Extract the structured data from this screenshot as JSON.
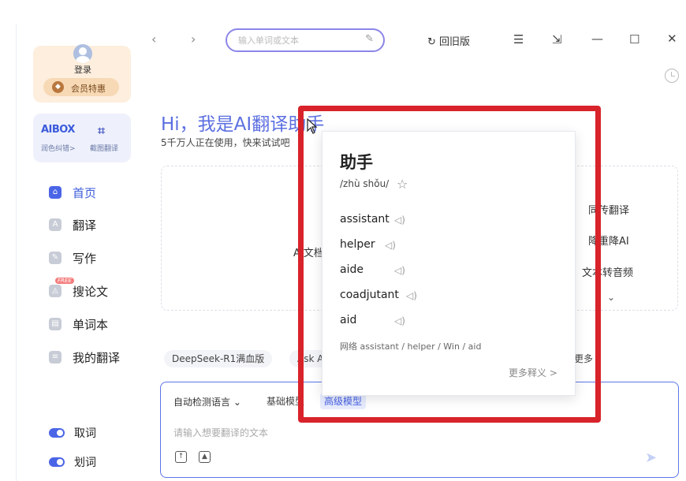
{
  "sidebar": {
    "login_label": "登录",
    "vip_label": "会员特惠",
    "vip_icon": "diamond-icon",
    "tools": {
      "polish_logo": "AIBOX",
      "polish_label": "润色纠错>",
      "screenshot_label": "截图翻译"
    },
    "nav": [
      {
        "label": "首页",
        "icon": "home-icon",
        "active": true
      },
      {
        "label": "翻译",
        "icon": "translate-icon",
        "active": false
      },
      {
        "label": "写作",
        "icon": "pen-icon",
        "active": false
      },
      {
        "label": "搜论文",
        "icon": "graduation-cap-icon",
        "active": false,
        "badge": "FREE"
      },
      {
        "label": "单词本",
        "icon": "book-icon",
        "active": false
      },
      {
        "label": "我的翻译",
        "icon": "document-icon",
        "active": false
      }
    ],
    "toggles": [
      {
        "label": "取词",
        "on": true
      },
      {
        "label": "划词",
        "on": true
      }
    ]
  },
  "topbar": {
    "search_placeholder": "输入单词或文本",
    "old_version_label": "回旧版",
    "window_controls": [
      "menu-icon",
      "pin-icon",
      "minimize-icon",
      "maximize-icon",
      "close-icon"
    ]
  },
  "hero": {
    "title": "Hi，我是AI翻译助手",
    "subtitle": "5千万人正在使用，快来试试吧",
    "ai_doc_label": "AI文档",
    "features": [
      "同传翻译",
      "降重降AI",
      "文本转音频"
    ]
  },
  "chips": [
    "DeepSeek-R1满血版",
    "Ask A",
    "更多"
  ],
  "translate_box": {
    "lang_select": "自动检测语言",
    "model_basic": "基础模型",
    "model_advanced": "高级模型",
    "placeholder": "请输入想要翻译的文本"
  },
  "popup": {
    "word": "助手",
    "pinyin": "/zhù shǒu/",
    "definitions": [
      "assistant",
      "helper",
      "aide",
      "coadjutant",
      "aid"
    ],
    "net_prefix": "网络",
    "net_text": "assistant / helper / Win / aid",
    "more_label": "更多释义 >"
  },
  "colors": {
    "accent": "#4a65e6",
    "highlight_frame": "#d8232a",
    "vip_bg": "#fdeedd"
  }
}
